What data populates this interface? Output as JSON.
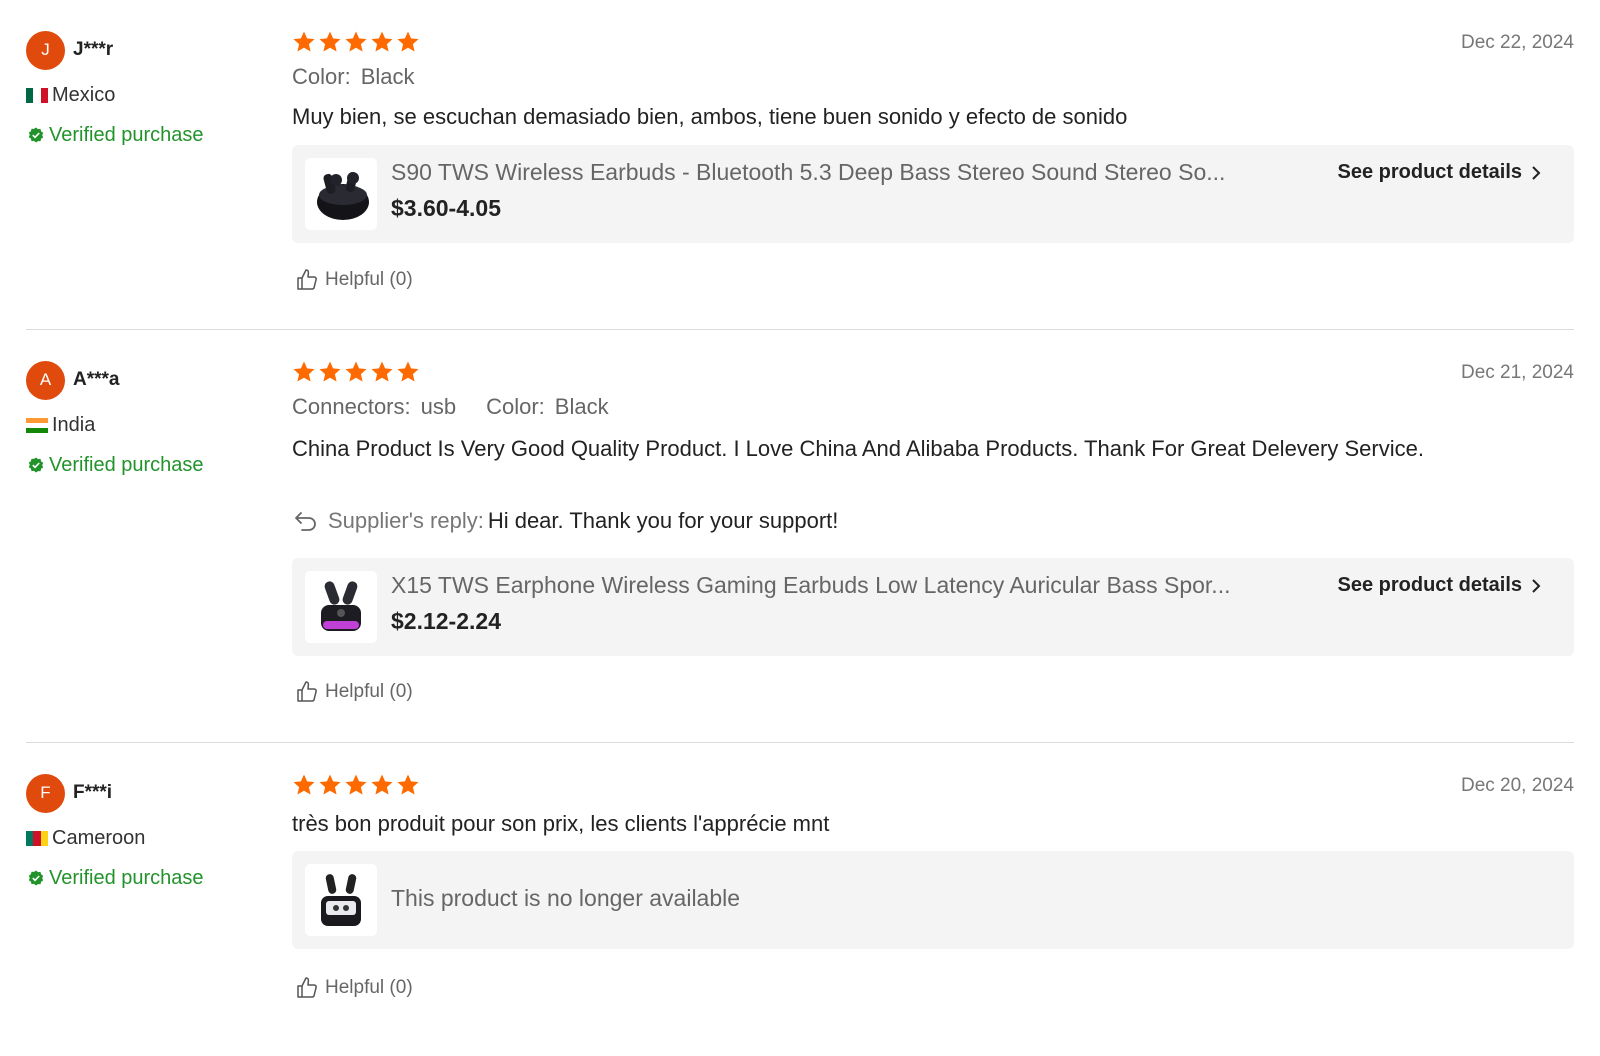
{
  "reviews": [
    {
      "avatar_letter": "J",
      "name": "J***r",
      "country": "Mexico",
      "verified_label": "Verified purchase",
      "rating": 5,
      "date": "Dec 22, 2024",
      "attributes": [
        {
          "label": "Color:",
          "value": "Black"
        }
      ],
      "text": "Muy bien, se escuchan demasiado bien, ambos, tiene buen sonido y efecto de sonido",
      "product": {
        "title": "S90 TWS Wireless Earbuds - Bluetooth 5.3 Deep Bass Stereo Sound Stereo So...",
        "price": "$3.60-4.05",
        "details_label": "See product details"
      },
      "helpful_label": "Helpful (0)"
    },
    {
      "avatar_letter": "A",
      "name": "A***a",
      "country": "India",
      "verified_label": "Verified purchase",
      "rating": 5,
      "date": "Dec 21, 2024",
      "attributes": [
        {
          "label": "Connectors:",
          "value": "usb"
        },
        {
          "label": "Color:",
          "value": "Black"
        }
      ],
      "text": "China Product Is Very Good Quality Product. I Love China And Alibaba Products. Thank For Great Delevery Service.",
      "reply": {
        "label": "Supplier's reply:",
        "text": "Hi dear. Thank you for your support!"
      },
      "product": {
        "title": "X15 TWS Earphone Wireless Gaming Earbuds Low Latency Auricular Bass Spor...",
        "price": "$2.12-2.24",
        "details_label": "See product details"
      },
      "helpful_label": "Helpful (0)"
    },
    {
      "avatar_letter": "F",
      "name": "F***i",
      "country": "Cameroon",
      "verified_label": "Verified purchase",
      "rating": 5,
      "date": "Dec 20, 2024",
      "text": "très bon produit pour son prix, les clients l'apprécie mnt",
      "product": {
        "unavailable_label": "This product is no longer available"
      },
      "helpful_label": "Helpful (0)"
    }
  ],
  "colors": {
    "accent": "#e04a0c",
    "star": "#ff6a00",
    "verified": "#22932b"
  }
}
